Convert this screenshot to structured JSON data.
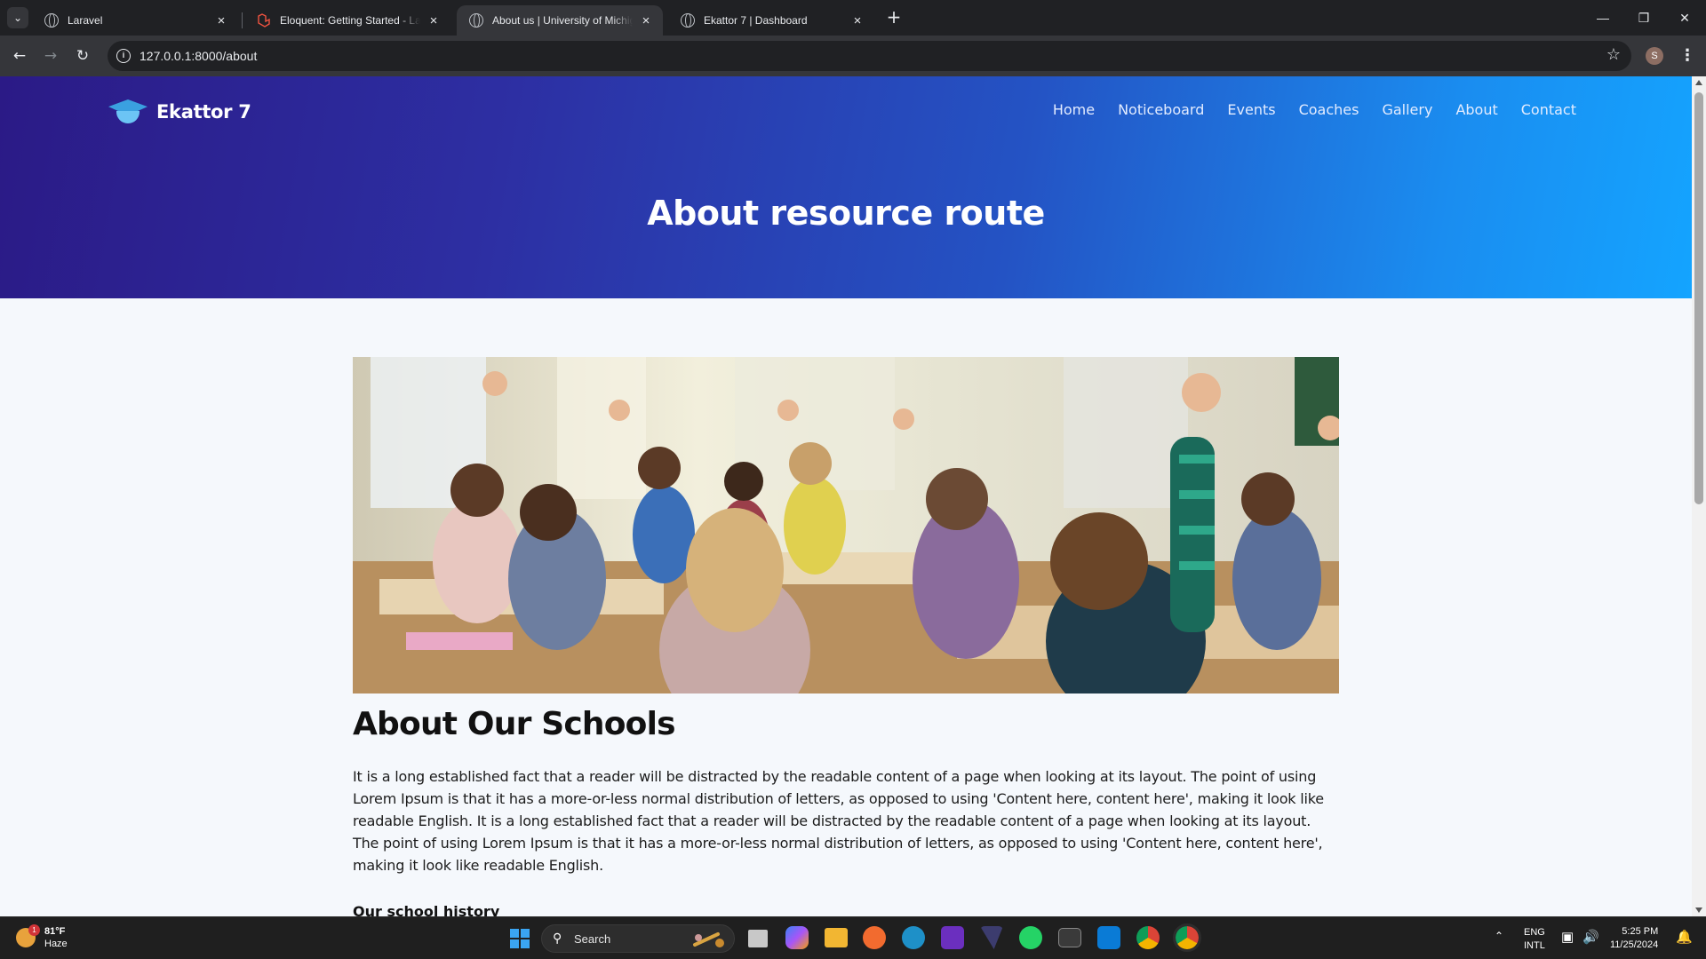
{
  "browser": {
    "tabs": [
      {
        "title": "Laravel",
        "active": false
      },
      {
        "title": "Eloquent: Getting Started - Laravel",
        "active": false
      },
      {
        "title": "About us | University of Michigan",
        "active": true
      },
      {
        "title": "Ekattor 7 | Dashboard",
        "active": false
      }
    ],
    "url": "127.0.0.1:8000/about",
    "profile_initial": "S"
  },
  "site": {
    "logo_text": "Ekattor 7",
    "nav": [
      "Home",
      "Noticeboard",
      "Events",
      "Coaches",
      "Gallery",
      "About",
      "Contact"
    ],
    "hero_title": "About resource route"
  },
  "content": {
    "section_title": "About Our Schools",
    "paragraph": "It is a long established fact that a reader will be distracted by the readable content of a page when looking at its layout. The point of using Lorem Ipsum is that it has a more-or-less normal distribution of letters, as opposed to using 'Content here, content here', making it look like readable English. It is a long established fact that a reader will be distracted by the readable content of a page when looking at its layout. The point of using Lorem Ipsum is that it has a more-or-less normal distribution of letters, as opposed to using 'Content here, content here', making it look like readable English.",
    "subheading": "Our school history"
  },
  "taskbar": {
    "weather_temp": "81°F",
    "weather_desc": "Haze",
    "weather_badge": "1",
    "search_label": "Search",
    "lang_line1": "ENG",
    "lang_line2": "INTL",
    "time": "5:25 PM",
    "date": "11/25/2024"
  },
  "colors": {
    "hero_start": "#2b1a86",
    "hero_end": "#14a4ff",
    "page_bg": "#f5f8fc",
    "chrome_dark": "#202124"
  }
}
